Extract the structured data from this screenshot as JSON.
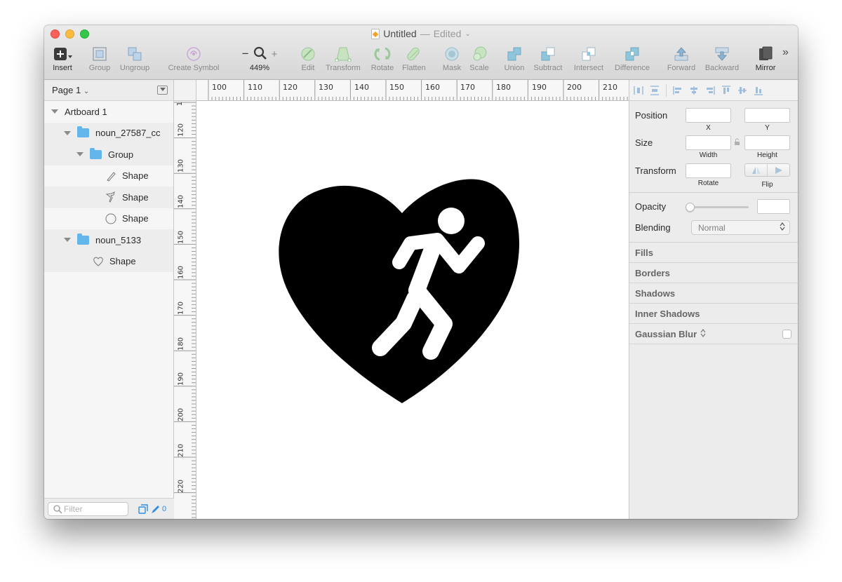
{
  "window": {
    "title": "Untitled",
    "separator": "—",
    "status": "Edited"
  },
  "toolbar": {
    "insert": "Insert",
    "group": "Group",
    "ungroup": "Ungroup",
    "create_symbol": "Create Symbol",
    "zoom_minus": "−",
    "zoom_plus": "+",
    "zoom_value": "449%",
    "edit": "Edit",
    "transform": "Transform",
    "rotate": "Rotate",
    "flatten": "Flatten",
    "mask": "Mask",
    "scale": "Scale",
    "union": "Union",
    "subtract": "Subtract",
    "intersect": "Intersect",
    "difference": "Difference",
    "forward": "Forward",
    "backward": "Backward",
    "mirror": "Mirror",
    "overflow": "»"
  },
  "layers": {
    "page": "Page 1",
    "items": [
      {
        "label": "Artboard 1"
      },
      {
        "label": "noun_27587_cc"
      },
      {
        "label": "Group"
      },
      {
        "label": "Shape"
      },
      {
        "label": "Shape"
      },
      {
        "label": "Shape"
      },
      {
        "label": "noun_5133"
      },
      {
        "label": "Shape"
      }
    ],
    "filter_placeholder": "Filter",
    "filter_count": "0"
  },
  "rulers": {
    "horizontal": [
      "100",
      "110",
      "120",
      "130",
      "140",
      "150",
      "160",
      "170",
      "180",
      "190",
      "200",
      "210"
    ],
    "vertical": [
      "1",
      "120",
      "130",
      "140",
      "150",
      "160",
      "170",
      "180",
      "190",
      "200",
      "210",
      "220"
    ]
  },
  "inspector": {
    "position": "Position",
    "x": "X",
    "y": "Y",
    "size": "Size",
    "width": "Width",
    "height": "Height",
    "transform": "Transform",
    "rotate": "Rotate",
    "flip": "Flip",
    "opacity": "Opacity",
    "blending": "Blending",
    "blending_value": "Normal",
    "fills": "Fills",
    "borders": "Borders",
    "shadows": "Shadows",
    "inner_shadows": "Inner Shadows",
    "gaussian_blur": "Gaussian Blur",
    "blur_arrows": "⌃"
  },
  "colors": {
    "accent": "#2f8ee0",
    "folder": "#63b6ec",
    "close": "#fc605b",
    "minimize": "#fdbc40",
    "maximize": "#34c84a",
    "shape_fill": "#000000"
  }
}
